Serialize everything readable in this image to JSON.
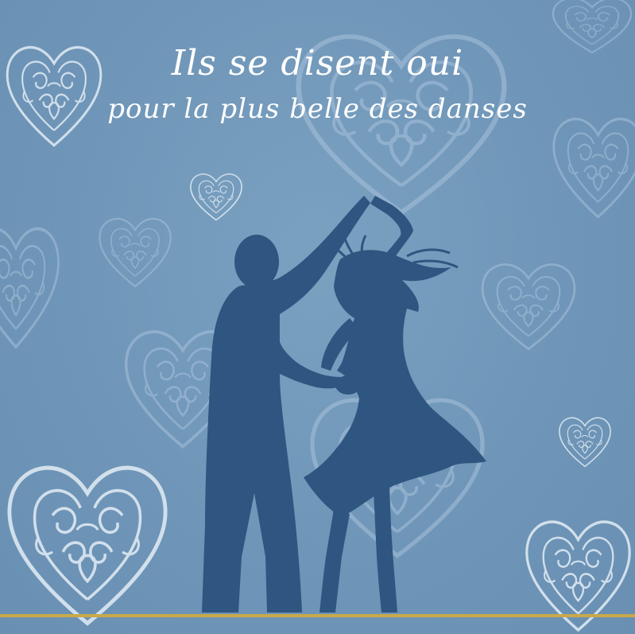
{
  "card": {
    "title_line1": "Ils se disent oui",
    "title_line2": "pour la plus belle des danses"
  },
  "colors": {
    "background": "#6f96b8",
    "heart_outline": "#b9cfe2",
    "heart_outline_bright": "#e4eef6",
    "silhouette": "#2f5680",
    "title_text": "#ffffff",
    "gold_rule": "#c9a94a"
  },
  "decor": {
    "hearts": "filigree-heart-icon",
    "couple": "dancing-couple-silhouette"
  }
}
